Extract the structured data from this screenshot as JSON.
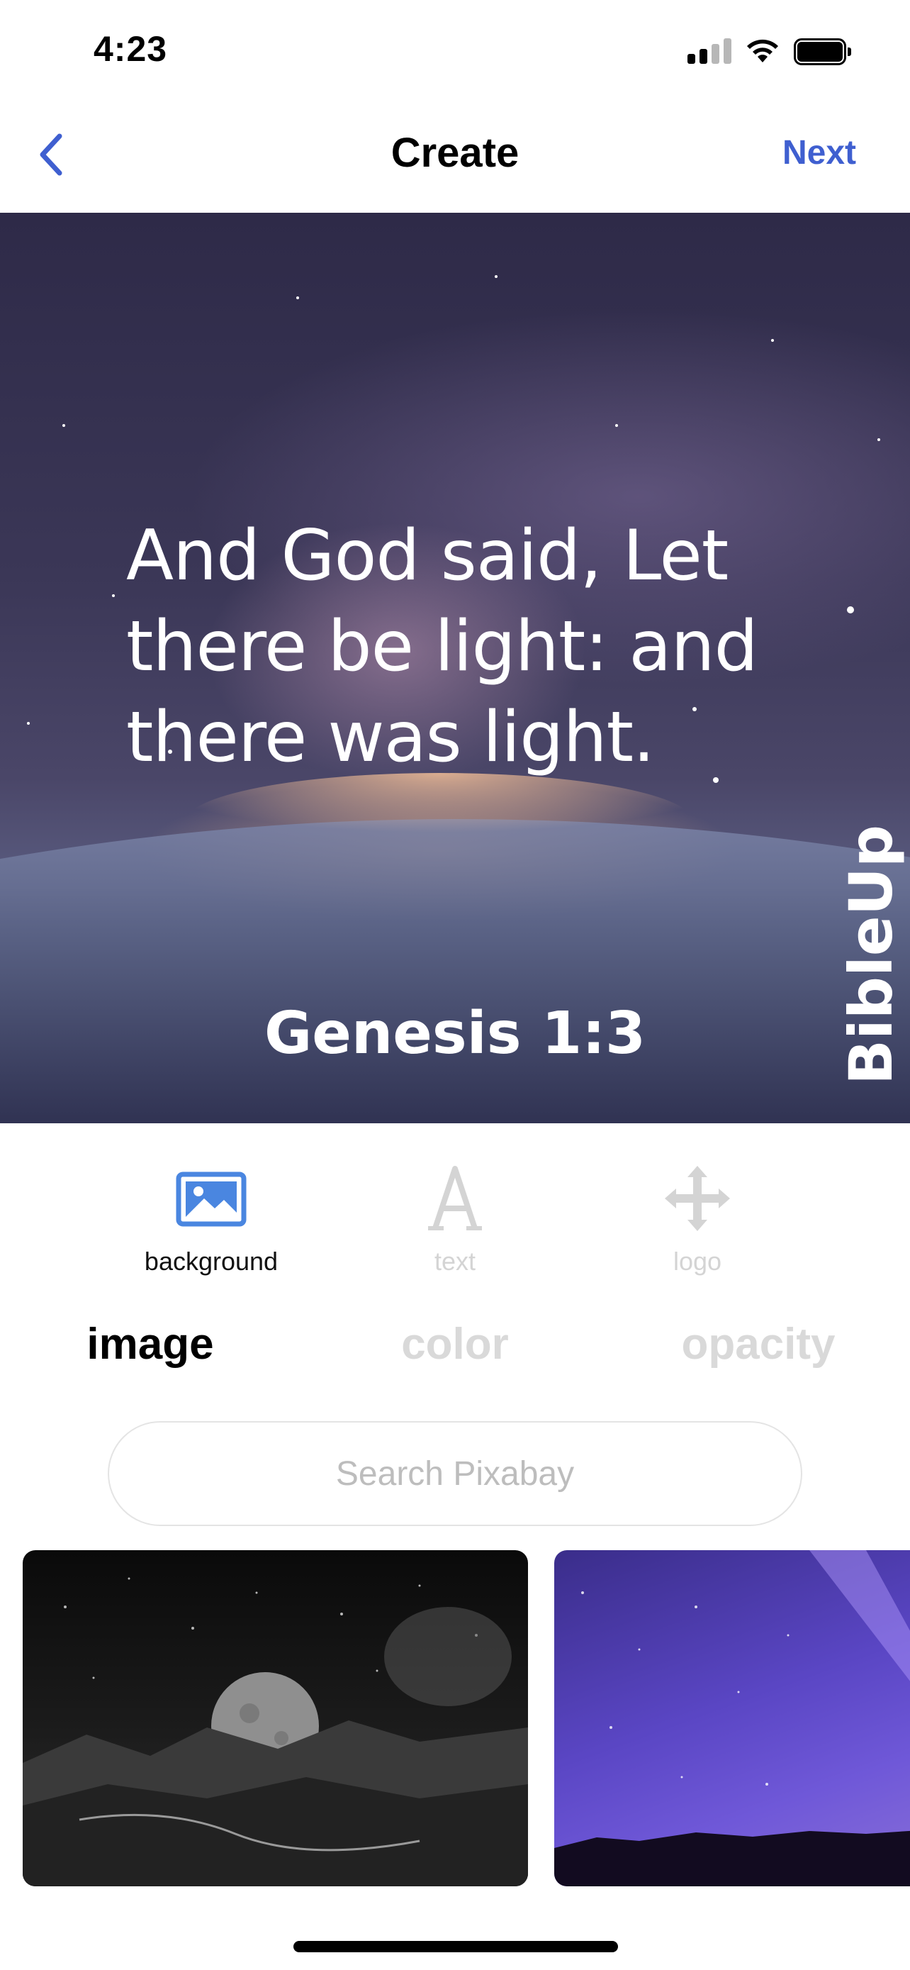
{
  "status_bar": {
    "time": "4:23",
    "icons": [
      "cellular-signal-icon",
      "wifi-icon",
      "battery-icon"
    ]
  },
  "nav": {
    "back_icon": "chevron-left-icon",
    "title": "Create",
    "next_label": "Next"
  },
  "preview": {
    "verse_text": "And God said, Let there be light: and there was light.",
    "reference": "Genesis 1:3",
    "logo_text": "BibleUp"
  },
  "tools": [
    {
      "label": "background",
      "icon": "image-icon",
      "active": true
    },
    {
      "label": "text",
      "icon": "letter-a-icon",
      "active": false
    },
    {
      "label": "logo",
      "icon": "move-arrows-icon",
      "active": false
    }
  ],
  "subtabs": [
    {
      "label": "image",
      "active": true
    },
    {
      "label": "color",
      "active": false
    },
    {
      "label": "opacity",
      "active": false
    }
  ],
  "search": {
    "placeholder": "Search Pixabay",
    "value": ""
  },
  "thumbnails": [
    {
      "description_icon": "moon-landscape-thumbnail"
    },
    {
      "description_icon": "purple-night-sky-thumbnail"
    }
  ],
  "colors": {
    "accent": "#3f5fd0",
    "active_icon": "#4a86e0",
    "inactive": "#d4d4d4"
  }
}
